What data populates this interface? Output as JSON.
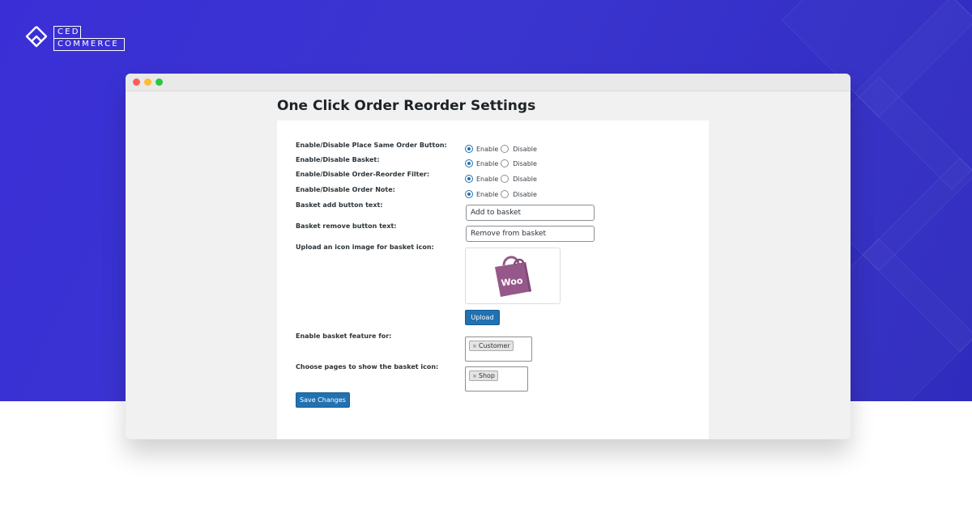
{
  "brand": {
    "logo_line1": "CED",
    "logo_line2": "COMMERCE"
  },
  "page": {
    "title": "One Click Order Reorder Settings"
  },
  "settings": {
    "place_same_order": {
      "label": "Enable/Disable Place Same Order Button:",
      "enable": "Enable",
      "disable": "Disable",
      "selected": "Enable"
    },
    "basket": {
      "label": "Enable/Disable Basket:",
      "enable": "Enable",
      "disable": "Disable",
      "selected": "Enable"
    },
    "order_filter": {
      "label": "Enable/Disable Order-Reorder Filter:",
      "enable": "Enable",
      "disable": "Disable",
      "selected": "Enable"
    },
    "order_note": {
      "label": "Enable/Disable Order Note:",
      "enable": "Enable",
      "disable": "Disable",
      "selected": "Enable"
    },
    "basket_add_text": {
      "label": "Basket add button text:",
      "value": "Add to basket"
    },
    "basket_remove_text": {
      "label": "Basket remove button text:",
      "value": "Remove from basket"
    },
    "basket_icon": {
      "label": "Upload an icon image for basket icon:",
      "preview_text": "Woo",
      "upload_label": "Upload"
    },
    "basket_feature_for": {
      "label": "Enable basket feature for:",
      "remove_symbol": "×",
      "selected": [
        "Customer"
      ]
    },
    "basket_pages": {
      "label": "Choose pages to show the basket icon:",
      "remove_symbol": "×",
      "selected": [
        "Shop"
      ]
    }
  },
  "actions": {
    "save_label": "Save Changes"
  },
  "colors": {
    "hero_blue": "#3a32d0",
    "wp_primary": "#2271b1",
    "woo_purple": "#96588a"
  }
}
